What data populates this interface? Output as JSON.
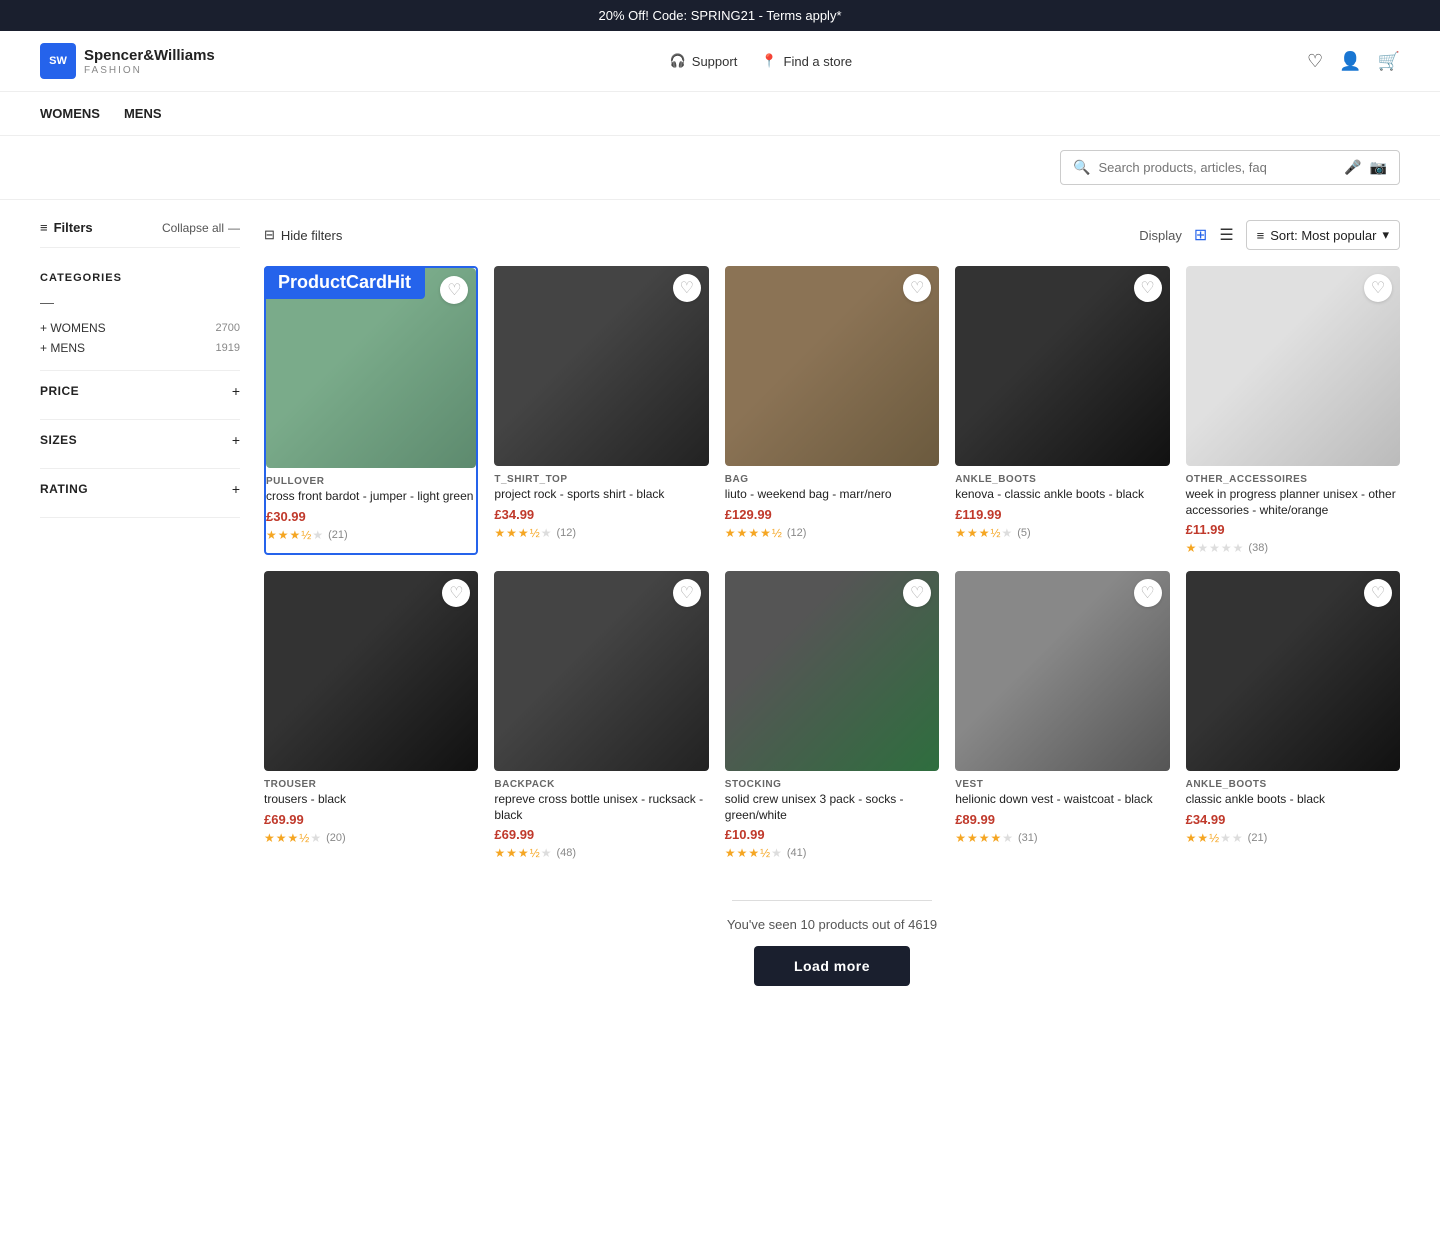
{
  "banner": {
    "text": "20% Off! Code: SPRING21 - Terms apply*"
  },
  "header": {
    "logo_initials": "SW",
    "brand_name": "Spencer&Williams",
    "brand_sub": "FASHION",
    "support_label": "Support",
    "find_store_label": "Find a store",
    "search_placeholder": "Search products, articles, faq"
  },
  "nav": {
    "items": [
      "WOMENS",
      "MENS"
    ]
  },
  "filters": {
    "label": "Filters",
    "collapse_label": "Collapse all",
    "categories_title": "CATEGORIES",
    "categories": [
      {
        "name": "+ WOMENS",
        "count": 2700
      },
      {
        "name": "+ MENS",
        "count": 1919
      }
    ],
    "sections": [
      {
        "id": "price",
        "title": "PRICE"
      },
      {
        "id": "sizes",
        "title": "SIZES"
      },
      {
        "id": "rating",
        "title": "RATING"
      }
    ]
  },
  "product_area": {
    "hide_filters_label": "Hide filters",
    "display_label": "Display",
    "sort_label": "Sort: Most popular",
    "products_seen_text": "You've seen 10 products out of 4619",
    "load_more_label": "Load more"
  },
  "product_card_hit_label": "ProductCardHit",
  "products": [
    {
      "id": 1,
      "category": "PULLOVER",
      "name": "cross front bardot - jumper - light green",
      "price": "£30.99",
      "rating": 3.5,
      "reviews": 21,
      "highlighted": true,
      "img_class": "img-pullover"
    },
    {
      "id": 2,
      "category": "T_SHIRT_TOP",
      "name": "project rock - sports shirt - black",
      "price": "£34.99",
      "rating": 3.5,
      "reviews": 12,
      "highlighted": false,
      "img_class": "img-tshirt"
    },
    {
      "id": 3,
      "category": "BAG",
      "name": "liuto - weekend bag - marr/nero",
      "price": "£129.99",
      "rating": 4.5,
      "reviews": 12,
      "highlighted": false,
      "img_class": "img-bag"
    },
    {
      "id": 4,
      "category": "ANKLE_BOOTS",
      "name": "kenova - classic ankle boots - black",
      "price": "£119.99",
      "rating": 3.5,
      "reviews": 5,
      "highlighted": false,
      "img_class": "img-boots"
    },
    {
      "id": 5,
      "category": "OTHER_ACCESSOIRES",
      "name": "week in progress planner unisex - other accessories - white/orange",
      "price": "£11.99",
      "rating": 1,
      "reviews": 38,
      "highlighted": false,
      "img_class": "img-accessory"
    },
    {
      "id": 6,
      "category": "TROUSER",
      "name": "trousers - black",
      "price": "£69.99",
      "rating": 3.5,
      "reviews": 20,
      "highlighted": false,
      "img_class": "img-trouser"
    },
    {
      "id": 7,
      "category": "BACKPACK",
      "name": "repreve cross bottle unisex - rucksack - black",
      "price": "£69.99",
      "rating": 3.5,
      "reviews": 48,
      "highlighted": false,
      "img_class": "img-backpack"
    },
    {
      "id": 8,
      "category": "STOCKING",
      "name": "solid crew unisex 3 pack - socks - green/white",
      "price": "£10.99",
      "rating": 3.5,
      "reviews": 41,
      "highlighted": false,
      "img_class": "img-stocking"
    },
    {
      "id": 9,
      "category": "VEST",
      "name": "helionic down vest - waistcoat - black",
      "price": "£89.99",
      "rating": 4,
      "reviews": 31,
      "highlighted": false,
      "img_class": "img-vest"
    },
    {
      "id": 10,
      "category": "ANKLE_BOOTS",
      "name": "classic ankle boots - black",
      "price": "£34.99",
      "rating": 2.5,
      "reviews": 21,
      "highlighted": false,
      "img_class": "img-ankle-boots2"
    }
  ]
}
